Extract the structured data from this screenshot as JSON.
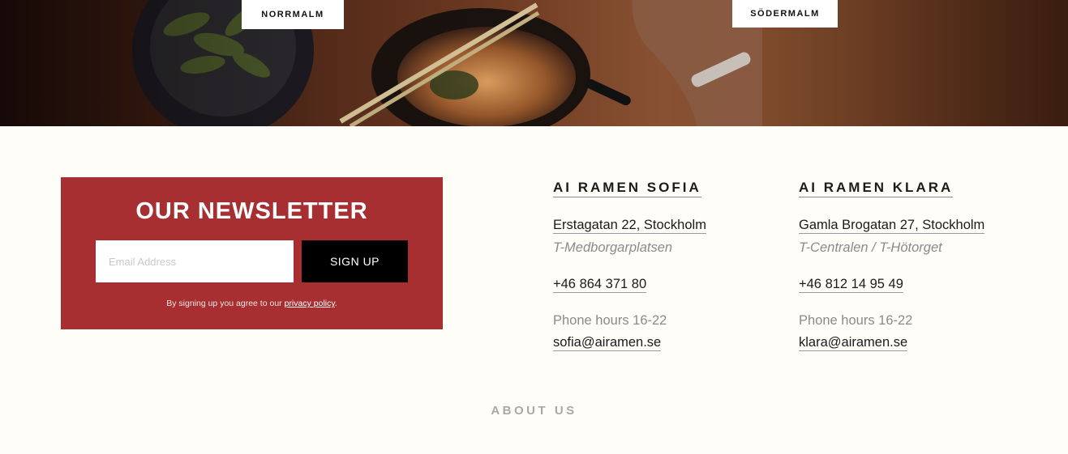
{
  "hero": {
    "buttons": {
      "norrmalm": "NORRMALM",
      "sodermalm": "SÖDERMALM"
    }
  },
  "newsletter": {
    "title": "OUR NEWSLETTER",
    "email_placeholder": "Email Address",
    "email_value": "",
    "signup_label": "SIGN UP",
    "terms_prefix": "By signing up you agree to our ",
    "terms_link": "privacy policy",
    "terms_suffix": "."
  },
  "locations": [
    {
      "name": "AI RAMEN SOFIA",
      "address": "Erstagatan 22, Stockholm",
      "station": "T-Medborgarplatsen",
      "phone": "+46 864 371 80",
      "hours": "Phone hours 16-22",
      "email": "sofia@airamen.se"
    },
    {
      "name": "AI RAMEN KLARA",
      "address": "Gamla Brogatan 27, Stockholm",
      "station": "T-Centralen / T-Hötorget",
      "phone": "+46 812 14 95 49",
      "hours": "Phone hours 16-22",
      "email": "klara@airamen.se"
    }
  ],
  "footer": {
    "about_label": "ABOUT US"
  },
  "colors": {
    "newsletter_bg": "#a72f31",
    "page_bg": "#fefdf8",
    "button_bg": "#000000"
  }
}
